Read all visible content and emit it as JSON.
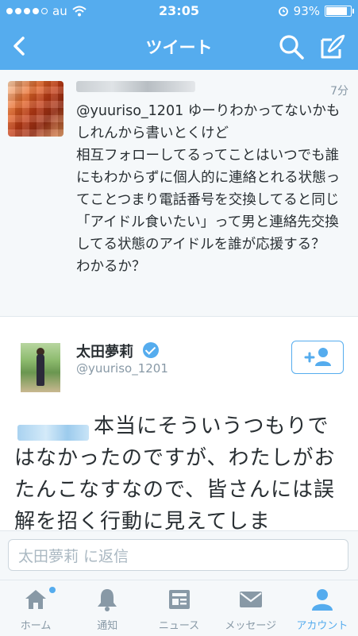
{
  "status_bar": {
    "carrier": "au",
    "time": "23:05",
    "battery": "93%",
    "battery_level": 0.93
  },
  "nav": {
    "title": "ツイート",
    "back_icon": "chevron-left-icon",
    "search_icon": "search-icon",
    "compose_icon": "compose-icon"
  },
  "parent_tweet": {
    "time": "7分",
    "text": "@yuuriso_1201 ゆーりわかってないかもしれんから書いとくけど\n相互フォローしてるってことはいつでも誰にもわからずに個人的に連絡とれる状態ってことつまり電話番号を交換してると同じ\n「アイドル食いたい」って男と連絡先交換してる状態のアイドルを誰が応援する？\nわかるか？"
  },
  "main_tweet": {
    "display_name": "太田夢莉",
    "handle": "@yuuriso_1201",
    "text": "本当にそういうつもりではなかったのですが、わたしがおたんこなすなので、皆さんには誤解を招く行動に見えてしま"
  },
  "reply": {
    "placeholder": "太田夢莉 に返信"
  },
  "tabs": [
    {
      "label": "ホーム",
      "icon": "home-icon"
    },
    {
      "label": "通知",
      "icon": "bell-icon"
    },
    {
      "label": "ニュース",
      "icon": "news-icon"
    },
    {
      "label": "メッセージ",
      "icon": "envelope-icon"
    },
    {
      "label": "アカウント",
      "icon": "person-icon"
    }
  ],
  "colors": {
    "accent": "#55acee",
    "text": "#292f33",
    "secondary": "#8899a6"
  }
}
